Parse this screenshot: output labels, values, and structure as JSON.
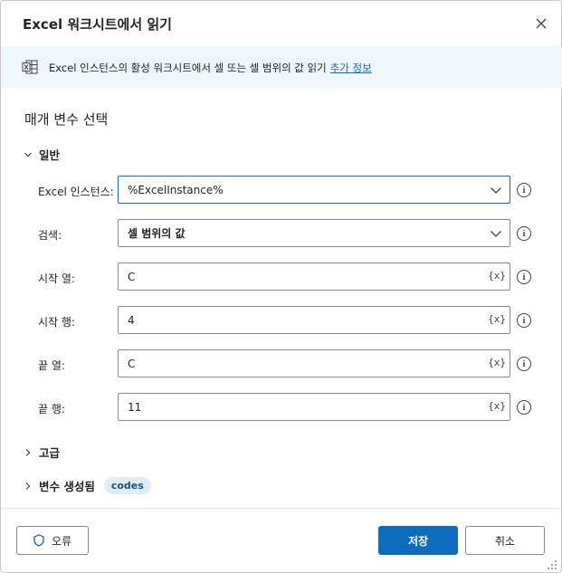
{
  "dialog": {
    "title": "Excel 워크시트에서 읽기",
    "close_icon": "close-icon"
  },
  "info": {
    "icon": "excel-sheet-icon",
    "text": "Excel 인스턴스의 활성 워크시트에서 셀 또는 셀 범위의 값 읽기",
    "link": "추가 정보"
  },
  "section": {
    "title": "매개 변수 선택"
  },
  "general": {
    "label": "일반",
    "fields": {
      "excel_instance": {
        "label": "Excel 인스턴스:",
        "value": "%ExcelInstance%"
      },
      "retrieve": {
        "label": "검색:",
        "value": "셀 범위의 값"
      },
      "start_column": {
        "label": "시작 열:",
        "value": "C",
        "var_button": "{x}"
      },
      "start_row": {
        "label": "시작 행:",
        "value": "4",
        "var_button": "{x}"
      },
      "end_column": {
        "label": "끝 열:",
        "value": "C",
        "var_button": "{x}"
      },
      "end_row": {
        "label": "끝 행:",
        "value": "11",
        "var_button": "{x}"
      }
    },
    "help_glyph": "i"
  },
  "advanced": {
    "label": "고급"
  },
  "variables": {
    "label": "변수 생성됨",
    "badge": "codes"
  },
  "footer": {
    "errors_label": "오류",
    "save_label": "저장",
    "cancel_label": "취소"
  },
  "colors": {
    "accent": "#0f6cbd",
    "info_bg": "#eff6fc",
    "badge_bg": "#e0ecf9"
  }
}
